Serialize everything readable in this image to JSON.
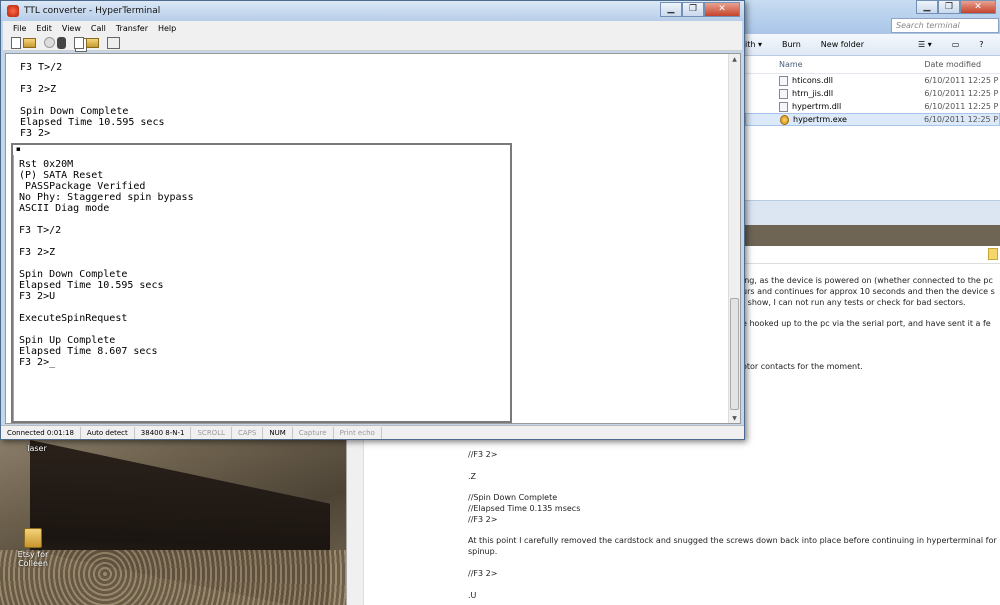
{
  "desktop": {
    "icons": [
      {
        "label": "laser"
      },
      {
        "label": "Etsy for Colleen"
      }
    ]
  },
  "explorer": {
    "search_placeholder": "Search terminal",
    "toolbar": [
      "ith ▾",
      "Burn",
      "New folder"
    ],
    "columns": {
      "name": "Name",
      "date": "Date modified"
    },
    "files": [
      {
        "name": "hticons.dll",
        "date": "6/10/2011 12:25 P",
        "type": "dll",
        "selected": false
      },
      {
        "name": "htrn_jis.dll",
        "date": "6/10/2011 12:25 P",
        "type": "dll",
        "selected": false
      },
      {
        "name": "hypertrm.dll",
        "date": "6/10/2011 12:25 P",
        "type": "dll",
        "selected": false
      },
      {
        "name": "hypertrm.exe",
        "date": "6/10/2011 12:25 P",
        "type": "exe",
        "selected": true
      }
    ]
  },
  "forum": {
    "lines": [
      "ing, as the device is powered on (whether connected to the pc",
      "urs and continues for approx 10 seconds and then the device s",
      "t show, I can not run any tests or check for bad sectors.",
      "e hooked up to the pc via the serial port, and have sent it a fe",
      "otor contacts for the moment.",
      "//F3 2>",
      ".Z",
      "//Spin Down Complete",
      "//Elapsed Time 0.135 msecs",
      "//F3 2>",
      "At this point I carefully removed the cardstock and snugged the screws down back into place before continuing in hyperterminal for",
      "spinup.",
      "//F3 2>",
      ".U"
    ]
  },
  "hyperterminal": {
    "title": "TTL converter - HyperTerminal",
    "menu": [
      "File",
      "Edit",
      "View",
      "Call",
      "Transfer",
      "Help"
    ],
    "outer_text": "F3 T>/2\n\nF3 2>Z\n\nSpin Down Complete\nElapsed Time 10.595 secs\nF3 2>",
    "inner_text": "Rst 0x20M\n(P) SATA Reset\n PASSPackage Verified\nNo Phy: Staggered spin bypass\nASCII Diag mode\n\nF3 T>/2\n\nF3 2>Z\n\nSpin Down Complete\nElapsed Time 10.595 secs\nF3 2>U\n\nExecuteSpinRequest\n\nSpin Up Complete\nElapsed Time 8.607 secs\nF3 2>_",
    "inner_marker": "▪",
    "status": [
      {
        "text": "Connected 0:01:18",
        "active": true
      },
      {
        "text": "Auto detect",
        "active": true
      },
      {
        "text": "38400 8-N-1",
        "active": true
      },
      {
        "text": "SCROLL",
        "active": false
      },
      {
        "text": "CAPS",
        "active": false
      },
      {
        "text": "NUM",
        "active": true
      },
      {
        "text": "Capture",
        "active": false
      },
      {
        "text": "Print echo",
        "active": false
      }
    ]
  }
}
